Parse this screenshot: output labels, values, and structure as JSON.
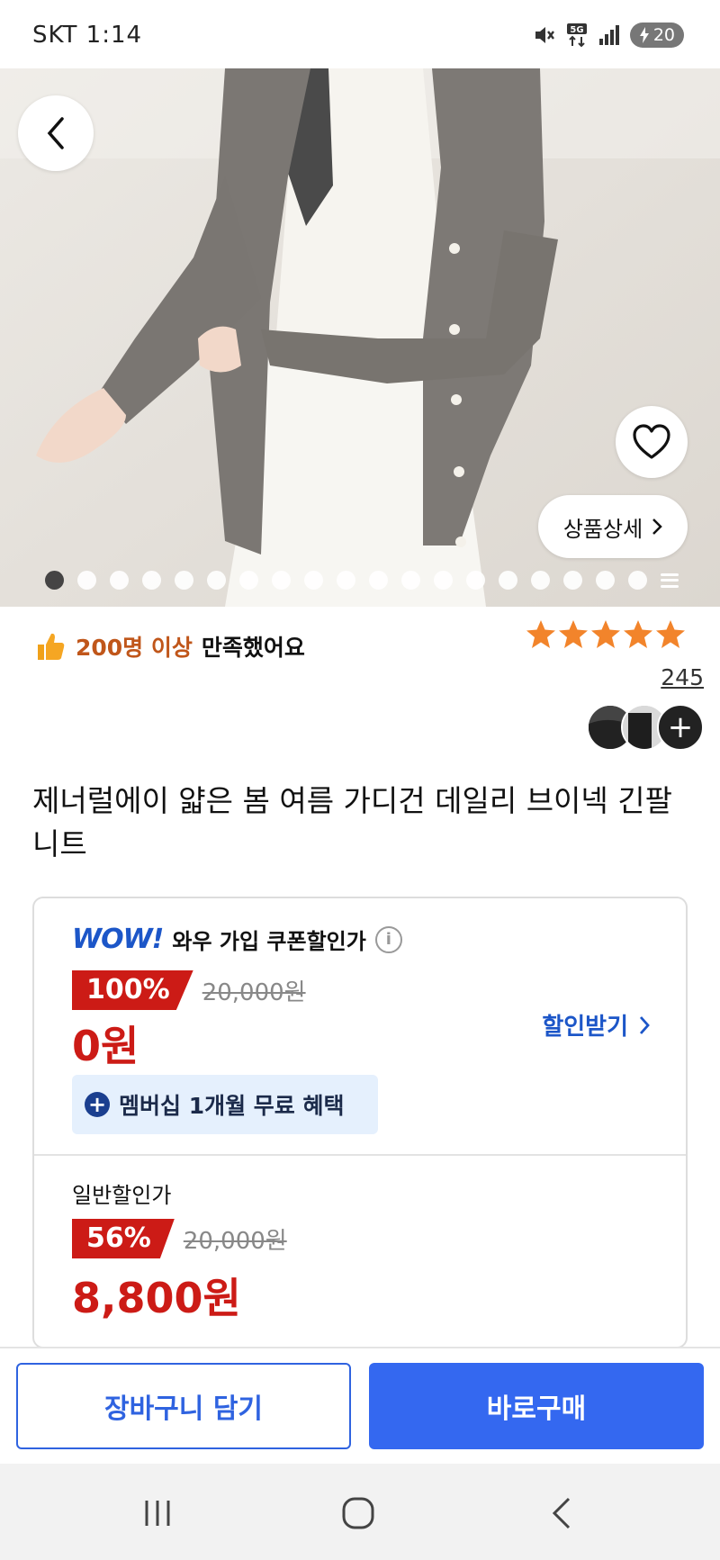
{
  "status_bar": {
    "time": "SKT 1:14",
    "battery": "20"
  },
  "hero": {
    "detail_button_label": "상품상세",
    "image_count": 19,
    "active_image_index": 0
  },
  "rating": {
    "satisfaction_count": "200명 이상",
    "satisfaction_text": "만족했어요",
    "stars": 5,
    "review_count": "245"
  },
  "product": {
    "title": "제너럴에이 얇은 봄 여름 가디건 데일리 브이넥 긴팔 니트"
  },
  "wow_price": {
    "logo": "WOW!",
    "label": "와우 가입 쿠폰할인가",
    "discount_pct": "100%",
    "original_price": "20,000원",
    "price": "0원",
    "discount_link": "할인받기",
    "membership_chip": "멤버십 1개월 무료 혜택"
  },
  "normal_price": {
    "label": "일반할인가",
    "discount_pct": "56%",
    "original_price": "20,000원",
    "price": "8,800원"
  },
  "actions": {
    "cart_label": "장바구니 담기",
    "buy_label": "바로구매"
  },
  "colors": {
    "accent_blue": "#3468f0",
    "price_red": "#cc1b16",
    "star_orange": "#f2842b"
  }
}
